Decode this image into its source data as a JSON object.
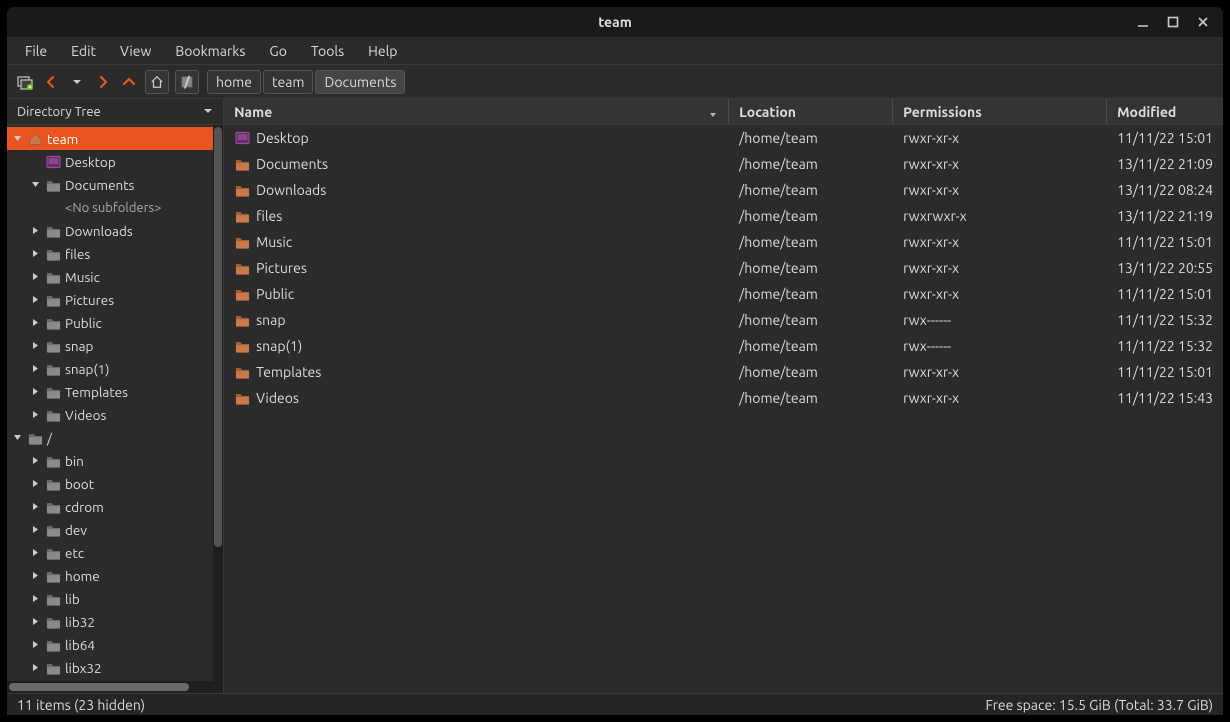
{
  "window": {
    "title": "team"
  },
  "menu": [
    "File",
    "Edit",
    "View",
    "Bookmarks",
    "Go",
    "Tools",
    "Help"
  ],
  "breadcrumb": {
    "root_glyph": "/",
    "segments": [
      "home",
      "team",
      "Documents"
    ],
    "active_index": 2
  },
  "sidebar": {
    "header": "Directory Tree",
    "no_subfolders": "<No subfolders>",
    "roots": [
      {
        "label": "team",
        "expanded": true,
        "selected": true,
        "icon": "home",
        "children": [
          {
            "label": "Desktop",
            "icon": "desktop",
            "expandable": false
          },
          {
            "label": "Documents",
            "icon": "folder-dark",
            "expandable": true,
            "expanded": true,
            "empty": true
          },
          {
            "label": "Downloads",
            "icon": "folder-dark",
            "expandable": true
          },
          {
            "label": "files",
            "icon": "folder-dark",
            "expandable": true
          },
          {
            "label": "Music",
            "icon": "folder-dark",
            "expandable": true
          },
          {
            "label": "Pictures",
            "icon": "folder-dark",
            "expandable": true
          },
          {
            "label": "Public",
            "icon": "folder-dark",
            "expandable": true
          },
          {
            "label": "snap",
            "icon": "folder-dark",
            "expandable": true
          },
          {
            "label": "snap(1)",
            "icon": "folder-dark",
            "expandable": true
          },
          {
            "label": "Templates",
            "icon": "folder-dark",
            "expandable": true
          },
          {
            "label": "Videos",
            "icon": "folder-dark",
            "expandable": true
          }
        ]
      },
      {
        "label": "/",
        "expanded": true,
        "icon": "folder-dark",
        "children": [
          {
            "label": "bin",
            "icon": "folder-dark",
            "expandable": true
          },
          {
            "label": "boot",
            "icon": "folder-dark",
            "expandable": true
          },
          {
            "label": "cdrom",
            "icon": "folder-dark",
            "expandable": true
          },
          {
            "label": "dev",
            "icon": "folder-dark",
            "expandable": true
          },
          {
            "label": "etc",
            "icon": "folder-dark",
            "expandable": true
          },
          {
            "label": "home",
            "icon": "folder-dark",
            "expandable": true
          },
          {
            "label": "lib",
            "icon": "folder-dark",
            "expandable": true
          },
          {
            "label": "lib32",
            "icon": "folder-dark",
            "expandable": true
          },
          {
            "label": "lib64",
            "icon": "folder-dark",
            "expandable": true
          },
          {
            "label": "libx32",
            "icon": "folder-dark",
            "expandable": true
          }
        ]
      }
    ]
  },
  "columns": {
    "name": "Name",
    "location": "Location",
    "permissions": "Permissions",
    "modified": "Modified"
  },
  "files": [
    {
      "name": "Desktop",
      "icon": "desktop",
      "location": "/home/team",
      "permissions": "rwxr-xr-x",
      "modified": "11/11/22 15:01"
    },
    {
      "name": "Documents",
      "icon": "folder",
      "location": "/home/team",
      "permissions": "rwxr-xr-x",
      "modified": "13/11/22 21:09"
    },
    {
      "name": "Downloads",
      "icon": "folder",
      "location": "/home/team",
      "permissions": "rwxr-xr-x",
      "modified": "13/11/22 08:24"
    },
    {
      "name": "files",
      "icon": "folder",
      "location": "/home/team",
      "permissions": "rwxrwxr-x",
      "modified": "13/11/22 21:19"
    },
    {
      "name": "Music",
      "icon": "folder",
      "location": "/home/team",
      "permissions": "rwxr-xr-x",
      "modified": "11/11/22 15:01"
    },
    {
      "name": "Pictures",
      "icon": "folder",
      "location": "/home/team",
      "permissions": "rwxr-xr-x",
      "modified": "13/11/22 20:55"
    },
    {
      "name": "Public",
      "icon": "folder",
      "location": "/home/team",
      "permissions": "rwxr-xr-x",
      "modified": "11/11/22 15:01"
    },
    {
      "name": "snap",
      "icon": "folder",
      "location": "/home/team",
      "permissions": "rwx------",
      "modified": "11/11/22 15:32"
    },
    {
      "name": "snap(1)",
      "icon": "folder",
      "location": "/home/team",
      "permissions": "rwx------",
      "modified": "11/11/22 15:32"
    },
    {
      "name": "Templates",
      "icon": "folder",
      "location": "/home/team",
      "permissions": "rwxr-xr-x",
      "modified": "11/11/22 15:01"
    },
    {
      "name": "Videos",
      "icon": "folder",
      "location": "/home/team",
      "permissions": "rwxr-xr-x",
      "modified": "11/11/22 15:43"
    }
  ],
  "status": {
    "left": "11 items (23 hidden)",
    "right": "Free space: 15.5 GiB (Total: 33.7 GiB)"
  }
}
